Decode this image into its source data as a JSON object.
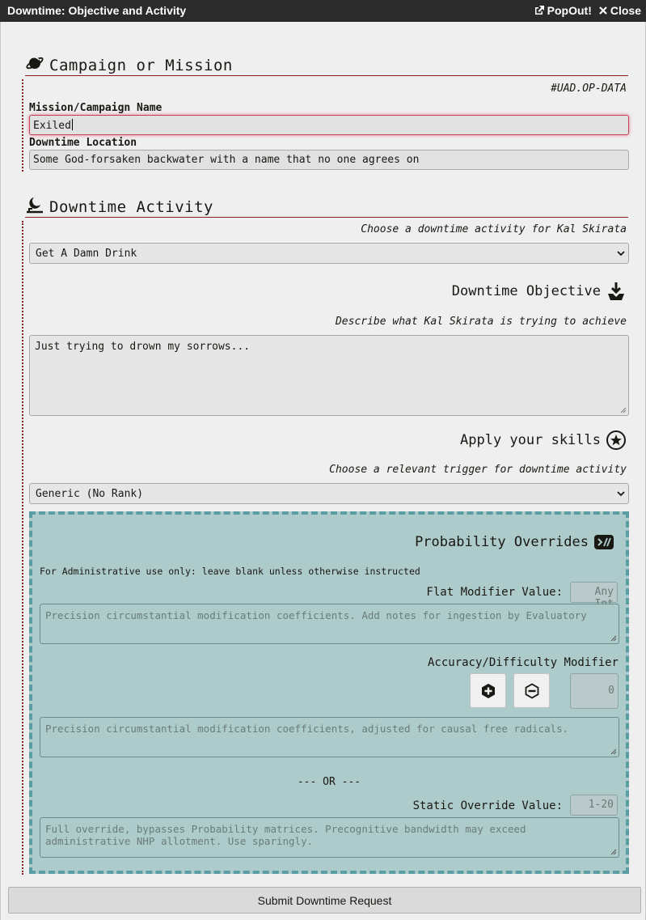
{
  "window": {
    "title": "Downtime: Objective and Activity",
    "popout_label": "PopOut!",
    "close_label": "Close"
  },
  "campaign": {
    "heading": "Campaign or Mission",
    "ref_code": "#UAD.OP-DATA",
    "name_label": "Mission/Campaign Name",
    "name_value": "Exiled",
    "location_label": "Downtime Location",
    "location_value": "Some God-forsaken backwater with a name that no one agrees on"
  },
  "activity": {
    "heading": "Downtime Activity",
    "choose_hint": "Choose a downtime activity for Kal Skirata",
    "selected_activity": "Get A Damn Drink",
    "objective_heading": "Downtime Objective",
    "objective_hint": "Describe what Kal Skirata is trying to achieve",
    "objective_text": "Just trying to drown my sorrows...",
    "skills_heading": "Apply your skills",
    "trigger_hint": "Choose a relevant trigger for downtime activity",
    "selected_trigger": "Generic (No Rank)"
  },
  "overrides": {
    "heading": "Probability Overrides",
    "admin_note": "For Administrative use only: leave blank unless otherwise instructed",
    "flat_label": "Flat Modifier Value:",
    "flat_placeholder": "Any Int",
    "flat_notes_placeholder": "Precision circumstantial modification coefficients. Add notes for ingestion by Evaluatory",
    "accuracy_label": "Accuracy/Difficulty Modifier",
    "accuracy_value": "0",
    "accuracy_notes_placeholder": "Precision circumstantial modification coefficients, adjusted for causal free radicals.",
    "or_separator": "--- OR ---",
    "static_label": "Static Override Value:",
    "static_placeholder": "1-20",
    "static_notes_placeholder": "Full override, bypasses Probability matrices. Precognitive bandwidth may exceed administrative NHP allotment. Use sparingly."
  },
  "submit_label": "Submit Downtime Request",
  "colors": {
    "accent_red": "#8b1d1d",
    "admin_bg": "#aecbcb",
    "admin_border": "#5a9ea3"
  }
}
